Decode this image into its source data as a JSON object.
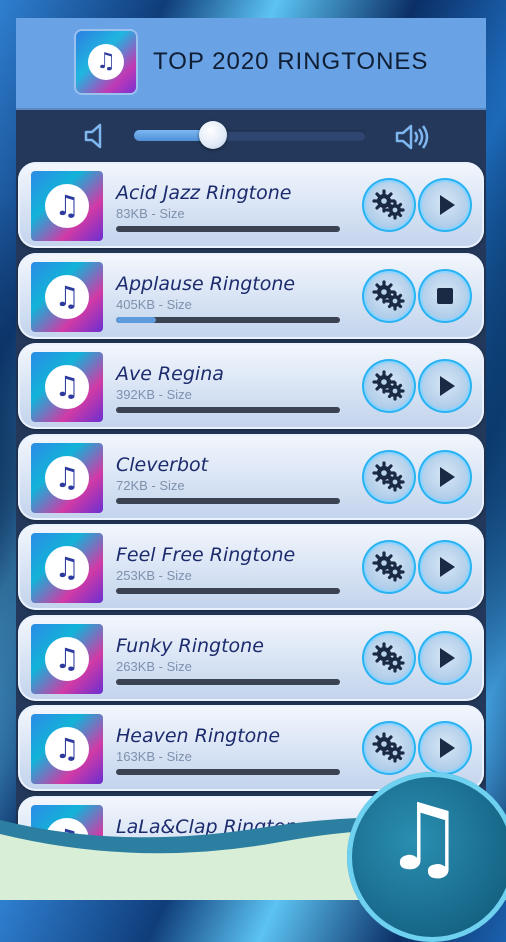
{
  "header": {
    "title": "TOP 2020 RINGTONES",
    "logo_icon": "music-note-icon"
  },
  "volume": {
    "low_icon": "volume-low-icon",
    "high_icon": "volume-high-icon",
    "level": 0.34
  },
  "ringtones": [
    {
      "title": "Acid Jazz Ringtone",
      "size": "83KB - Size",
      "state": "play",
      "progress": 0
    },
    {
      "title": "Applause Ringtone",
      "size": "405KB - Size",
      "state": "stop",
      "progress": 0.18
    },
    {
      "title": "Ave Regina",
      "size": "392KB - Size",
      "state": "play",
      "progress": 0
    },
    {
      "title": "Cleverbot",
      "size": "72KB - Size",
      "state": "play",
      "progress": 0
    },
    {
      "title": "Feel Free Ringtone",
      "size": "253KB - Size",
      "state": "play",
      "progress": 0
    },
    {
      "title": "Funky Ringtone",
      "size": "263KB - Size",
      "state": "play",
      "progress": 0
    },
    {
      "title": "Heaven Ringtone",
      "size": "163KB - Size",
      "state": "play",
      "progress": 0
    },
    {
      "title": "LaLa&Clap Ringtone",
      "size": "",
      "state": "play",
      "progress": 0
    }
  ],
  "colors": {
    "header_bg": "#6aa2e6",
    "panel_bg": "#23385a",
    "title_text": "#1c2b6d",
    "button_ring": "#2ab2f1"
  }
}
